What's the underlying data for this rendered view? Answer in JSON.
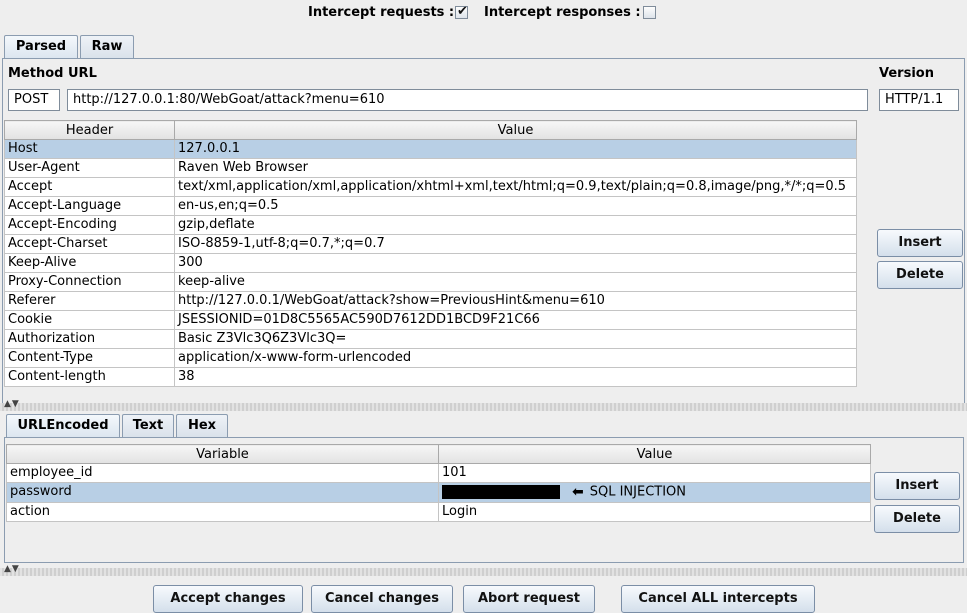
{
  "intercept": {
    "requests_label": "Intercept requests :",
    "requests_checked": true,
    "responses_label": "Intercept responses :",
    "responses_checked": false
  },
  "top_tabs": [
    {
      "label": "Parsed",
      "active": true
    },
    {
      "label": "Raw",
      "active": false
    }
  ],
  "request_line": {
    "method_label": "Method",
    "url_label": "URL",
    "version_label": "Version",
    "method": "POST",
    "url": "http://127.0.0.1:80/WebGoat/attack?menu=610",
    "version": "HTTP/1.1"
  },
  "headers_table": {
    "columns": [
      "Header",
      "Value"
    ],
    "rows": [
      {
        "name": "Host",
        "value": "127.0.0.1",
        "selected": true
      },
      {
        "name": "User-Agent",
        "value": "Raven Web Browser"
      },
      {
        "name": "Accept",
        "value": "text/xml,application/xml,application/xhtml+xml,text/html;q=0.9,text/plain;q=0.8,image/png,*/*;q=0.5"
      },
      {
        "name": "Accept-Language",
        "value": "en-us,en;q=0.5"
      },
      {
        "name": "Accept-Encoding",
        "value": "gzip,deflate"
      },
      {
        "name": "Accept-Charset",
        "value": "ISO-8859-1,utf-8;q=0.7,*;q=0.7"
      },
      {
        "name": "Keep-Alive",
        "value": "300"
      },
      {
        "name": "Proxy-Connection",
        "value": "keep-alive"
      },
      {
        "name": "Referer",
        "value": "http://127.0.0.1/WebGoat/attack?show=PreviousHint&menu=610"
      },
      {
        "name": "Cookie",
        "value": "JSESSIONID=01D8C5565AC590D7612DD1BCD9F21C66"
      },
      {
        "name": "Authorization",
        "value": "Basic Z3Vlc3Q6Z3Vlc3Q="
      },
      {
        "name": "Content-Type",
        "value": "application/x-www-form-urlencoded"
      },
      {
        "name": "Content-length",
        "value": "38"
      }
    ]
  },
  "header_buttons": {
    "insert": "Insert",
    "delete": "Delete"
  },
  "body_tabs": [
    {
      "label": "URLEncoded",
      "active": true
    },
    {
      "label": "Text",
      "active": false
    },
    {
      "label": "Hex",
      "active": false
    }
  ],
  "params_table": {
    "columns": [
      "Variable",
      "Value"
    ],
    "rows": [
      {
        "name": "employee_id",
        "value": "101"
      },
      {
        "name": "password",
        "value": "",
        "redacted": true,
        "annotation": "SQL INJECTION",
        "selected": true
      },
      {
        "name": "action",
        "value": "Login"
      }
    ]
  },
  "param_buttons": {
    "insert": "Insert",
    "delete": "Delete"
  },
  "bottom_buttons": {
    "accept": "Accept changes",
    "cancel": "Cancel changes",
    "abort": "Abort request",
    "cancel_all": "Cancel ALL intercepts"
  },
  "colors": {
    "selection": "#b8cfe5",
    "border": "#8b9cb0"
  }
}
